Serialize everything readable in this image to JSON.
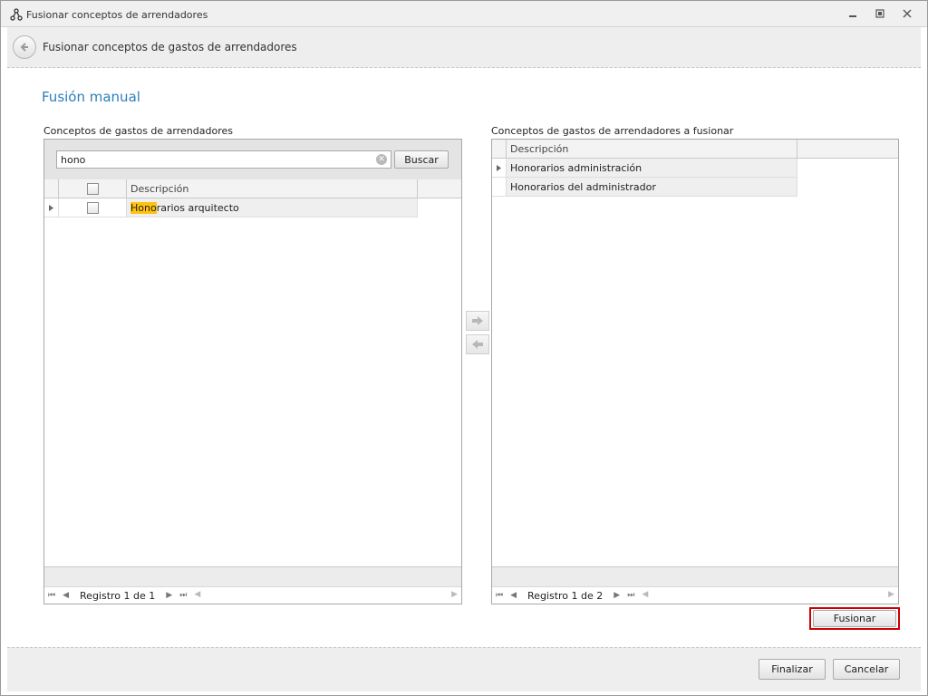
{
  "window": {
    "title": "Fusionar conceptos de arrendadores",
    "icons": [
      "merge-icon",
      "minimize-icon",
      "restore-icon",
      "close-icon"
    ]
  },
  "subheader": {
    "title": "Fusionar conceptos de gastos de arrendadores"
  },
  "section_title": "Fusión manual",
  "left": {
    "label": "Conceptos de gastos de arrendadores",
    "search": {
      "value": "hono",
      "button": "Buscar"
    },
    "column": "Descripción",
    "rows": [
      {
        "highlight": "Hono",
        "rest": "rarios arquitecto"
      }
    ],
    "navigator": "Registro 1 de 1"
  },
  "right": {
    "label": "Conceptos de gastos de arrendadores a fusionar",
    "column": "Descripción",
    "rows": [
      {
        "text": "Honorarios administración"
      },
      {
        "text": "Honorarios del administrador"
      }
    ],
    "navigator": "Registro 1 de 2"
  },
  "actions": {
    "fusionar": "Fusionar",
    "finalizar": "Finalizar",
    "cancelar": "Cancelar"
  },
  "colors": {
    "accent": "#2b80b9",
    "highlight": "#ffc20e",
    "focus_border": "#cc0000"
  }
}
